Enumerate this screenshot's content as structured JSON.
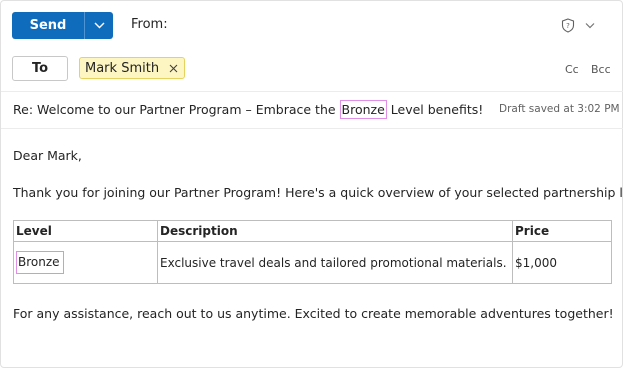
{
  "toolbar": {
    "send_label": "Send",
    "from_label": "From:"
  },
  "recipients": {
    "to_label": "To",
    "chip_name": "Mark Smith",
    "cc_label": "Cc",
    "bcc_label": "Bcc"
  },
  "subject": {
    "before": "Re: Welcome to our Partner Program – Embrace the ",
    "highlight": "Bronze",
    "after": " Level benefits!",
    "draft_status": "Draft saved at 3:02 PM"
  },
  "body": {
    "greeting": "Dear Mark,",
    "intro": "Thank you for joining our Partner Program! Here's a quick overview of your selected partnership level:",
    "table": {
      "headers": [
        "Level",
        "Description",
        "Price"
      ],
      "row": [
        "Bronze",
        "Exclusive travel deals and tailored promotional materials.",
        "$1,000"
      ]
    },
    "closing": "For any assistance, reach out to us anytime. Excited to create memorable adventures together!"
  },
  "icons": {
    "send_dropdown": "chevron-down-icon",
    "sensitivity": "shield-question-icon",
    "sensitivity_dropdown": "chevron-down-icon",
    "chip_remove": "close-icon"
  },
  "colors": {
    "accent": "#0f6cbd",
    "chip_bg": "#fdf6c3",
    "highlight_border": "#e28ee6"
  }
}
